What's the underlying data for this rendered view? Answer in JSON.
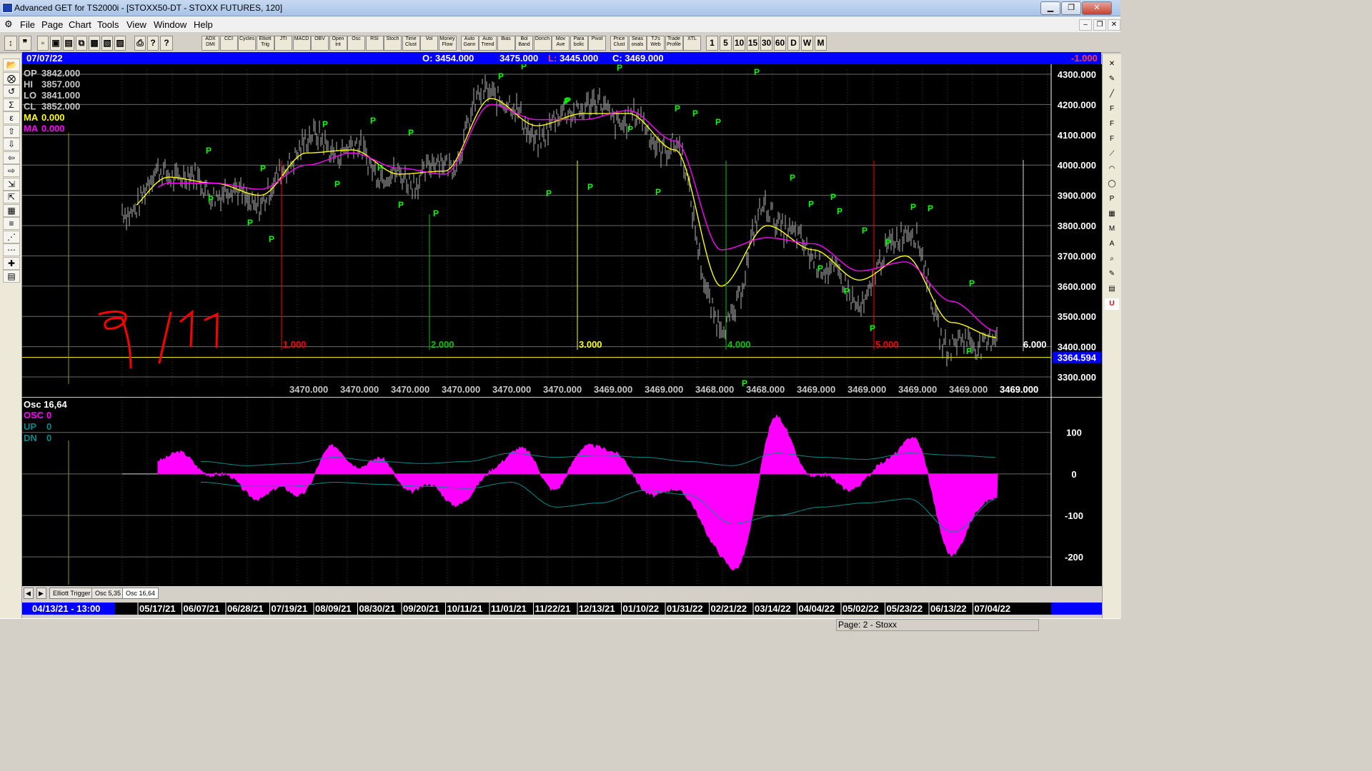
{
  "window": {
    "title": "Advanced GET for TS2000i - [STOXX50-DT - STOXX FUTURES, 120]",
    "minimize": "▁",
    "restore": "❐",
    "close": "✕"
  },
  "menu": [
    "File",
    "Page",
    "Chart",
    "Tools",
    "View",
    "Window",
    "Help"
  ],
  "toolbar": {
    "buttons": [
      "ADX DMI",
      "CCI",
      "Cycles",
      "Elliott Trig",
      "JTI",
      "MACD",
      "OBV",
      "Open Int",
      "Osc",
      "RSI",
      "Stoch",
      "Time Clust",
      "Vol",
      "Money Flow",
      "Auto Gann",
      "Auto Trend",
      "Bias",
      "Bol Band",
      "Donch",
      "Mov Ave",
      "Para bolic",
      "Pivot",
      "Price Clust",
      "Seas onals",
      "TJ's Web",
      "Trade Profile",
      "XTL"
    ],
    "intervals": [
      "1",
      "5",
      "10",
      "15",
      "30",
      "60",
      "D",
      "W",
      "M"
    ]
  },
  "left_tools": [
    "folder-icon",
    "gann-icon",
    "reset-icon",
    "study-icon",
    "elliott-icon",
    "up-arrow-icon",
    "down-arrow-icon",
    "left-arrow-icon",
    "right-arrow-icon",
    "compress-icon",
    "expand-icon",
    "grid-icon",
    "lines-icon",
    "gann-fan-icon",
    "fib-icon",
    "crosshair-icon",
    "save-icon"
  ],
  "right_tools": [
    "close-x-icon",
    "pencil-icon",
    "line-icon",
    "fib-ret-icon",
    "fib-ext-icon",
    "fib-time-icon",
    "trend-icon",
    "arc-icon",
    "ellipse-icon",
    "pti-icon",
    "grid2-icon",
    "mob-icon",
    "text-icon",
    "zoom-icon",
    "paint-icon",
    "erase-icon",
    "u-icon"
  ],
  "header": {
    "date": "07/07/22",
    "open": "O: 3454.000",
    "high": "3475.000",
    "low_label": "L:",
    "low": "3445.000",
    "close": "C: 3469.000",
    "change": "-1.000"
  },
  "legend": [
    {
      "label": "OP",
      "value": "3842.000",
      "color": "#c8c8c8"
    },
    {
      "label": "HI",
      "value": "3857.000",
      "color": "#c8c8c8"
    },
    {
      "label": "LO",
      "value": "3841.000",
      "color": "#c8c8c8"
    },
    {
      "label": "CL",
      "value": "3852.000",
      "color": "#c8c8c8"
    },
    {
      "label": "MA",
      "value": "0.000",
      "color": "#ffff00"
    },
    {
      "label": "MA",
      "value": "0.000",
      "color": "#ff00ff"
    }
  ],
  "osc_legend": {
    "title": "Osc 16,64",
    "rows": [
      {
        "label": "OSC",
        "value": "0",
        "color": "#ff00ff"
      },
      {
        "label": "UP",
        "value": "0",
        "color": "#008b8b"
      },
      {
        "label": "DN",
        "value": "0",
        "color": "#008b8b"
      }
    ]
  },
  "annotation_handwritten": "9/11",
  "tabs": [
    "Elliott Trigger",
    "Osc 5,35",
    "Osc 16,64"
  ],
  "datebar": {
    "start": "04/13/21 - 13:00",
    "dates": [
      "05/17/21",
      "06/07/21",
      "06/28/21",
      "07/19/21",
      "08/09/21",
      "08/30/21",
      "09/20/21",
      "10/11/21",
      "11/01/21",
      "11/22/21",
      "12/13/21",
      "01/10/22",
      "01/31/22",
      "02/21/22",
      "03/14/22",
      "04/04/22",
      "05/02/22",
      "05/23/22",
      "06/13/22",
      "07/04/22"
    ]
  },
  "status": "Page: 2 - Stoxx",
  "colors": {
    "price": "#b4b4b4",
    "ma_fast": "#ffff00",
    "ma_slow": "#ff00ff",
    "pivot_label": "#00ff00",
    "osc_fill": "#ff00ff",
    "osc_band": "#008b8b",
    "cycle_red": "#ff0000",
    "cycle_green": "#00c800",
    "cycle_yellow": "#ffff00"
  },
  "chart_data": [
    {
      "type": "line",
      "title": "STOXX50-DT - STOXX FUTURES, 120",
      "y_axis": {
        "ylim": [
          3250,
          4320
        ],
        "ticks": [
          "4300.000",
          "4200.000",
          "4100.000",
          "4000.000",
          "3900.000",
          "3800.000",
          "3700.000",
          "3600.000",
          "3500.000",
          "3400.000",
          "3300.000"
        ]
      },
      "x": [
        "05/17/21",
        "06/07/21",
        "06/28/21",
        "07/19/21",
        "08/09/21",
        "08/30/21",
        "09/20/21",
        "10/11/21",
        "11/01/21",
        "11/22/21",
        "12/13/21",
        "01/10/22",
        "01/31/22",
        "02/21/22",
        "03/14/22",
        "04/04/22",
        "05/02/22",
        "05/23/22",
        "06/13/22",
        "07/04/22"
      ],
      "series": [
        {
          "name": "Price",
          "values": [
            3850,
            3980,
            3920,
            3880,
            4080,
            4050,
            3950,
            4000,
            4250,
            4100,
            4200,
            4150,
            4050,
            3450,
            3850,
            3700,
            3550,
            3800,
            3400,
            3430
          ]
        },
        {
          "name": "MA",
          "values": [
            3840,
            3960,
            3940,
            3900,
            4040,
            4050,
            3970,
            3980,
            4220,
            4130,
            4170,
            4170,
            4050,
            3600,
            3800,
            3720,
            3620,
            3700,
            3480,
            3430
          ]
        },
        {
          "name": "MA",
          "values": [
            3830,
            3940,
            3940,
            3920,
            4000,
            4040,
            3990,
            3970,
            4200,
            4150,
            4150,
            4180,
            4080,
            3720,
            3760,
            3740,
            3650,
            3680,
            3550,
            3450
          ]
        }
      ],
      "current_price": "3364.594",
      "cycle_labels": [
        "1.000",
        "2.000",
        "3.000",
        "4.000",
        "5.000",
        "6.000"
      ],
      "x_price_labels": [
        "3470.000",
        "3470.000",
        "3470.000",
        "3470.000",
        "3470.000",
        "3470.000",
        "3469.000",
        "3469.000",
        "3468.000",
        "3468.000",
        "3469.000",
        "3469.000",
        "3469.000",
        "3469.000",
        "3469.000"
      ],
      "pivots": [
        "P",
        "P",
        "P",
        "P",
        "P",
        "P",
        "P",
        "P",
        "P",
        "P",
        "P",
        "P",
        "P",
        "P",
        "P",
        "P",
        "P",
        "P",
        "P",
        "P",
        "P",
        "P",
        "P",
        "P",
        "P",
        "P",
        "P",
        "P",
        "P",
        "P",
        "P",
        "P",
        "P",
        "P",
        "P",
        "P",
        "P",
        "P",
        "P"
      ]
    },
    {
      "type": "area",
      "title": "Osc 16,64",
      "y_axis": {
        "ylim": [
          -260,
          170
        ],
        "ticks": [
          "100",
          "0",
          "-100",
          "-200"
        ]
      },
      "x": [
        "05/17/21",
        "06/07/21",
        "06/28/21",
        "07/19/21",
        "08/09/21",
        "08/30/21",
        "09/20/21",
        "10/11/21",
        "11/01/21",
        "11/22/21",
        "12/13/21",
        "01/10/22",
        "01/31/22",
        "02/21/22",
        "03/14/22",
        "04/04/22",
        "05/02/22",
        "05/23/22",
        "06/13/22",
        "07/04/22"
      ],
      "series": [
        {
          "name": "OSC",
          "values": [
            50,
            20,
            -40,
            -50,
            50,
            20,
            -40,
            -60,
            60,
            -20,
            80,
            -30,
            -60,
            -240,
            120,
            -20,
            -20,
            90,
            -180,
            -40
          ]
        },
        {
          "name": "UP",
          "values": [
            40,
            30,
            20,
            25,
            40,
            30,
            25,
            30,
            50,
            40,
            45,
            40,
            30,
            20,
            50,
            40,
            35,
            50,
            45,
            40
          ]
        },
        {
          "name": "DN",
          "values": [
            -20,
            -20,
            -30,
            -30,
            -20,
            -25,
            -30,
            -35,
            -20,
            -80,
            -70,
            -40,
            -50,
            -120,
            -100,
            -80,
            -70,
            -60,
            -140,
            -60
          ]
        }
      ]
    }
  ]
}
